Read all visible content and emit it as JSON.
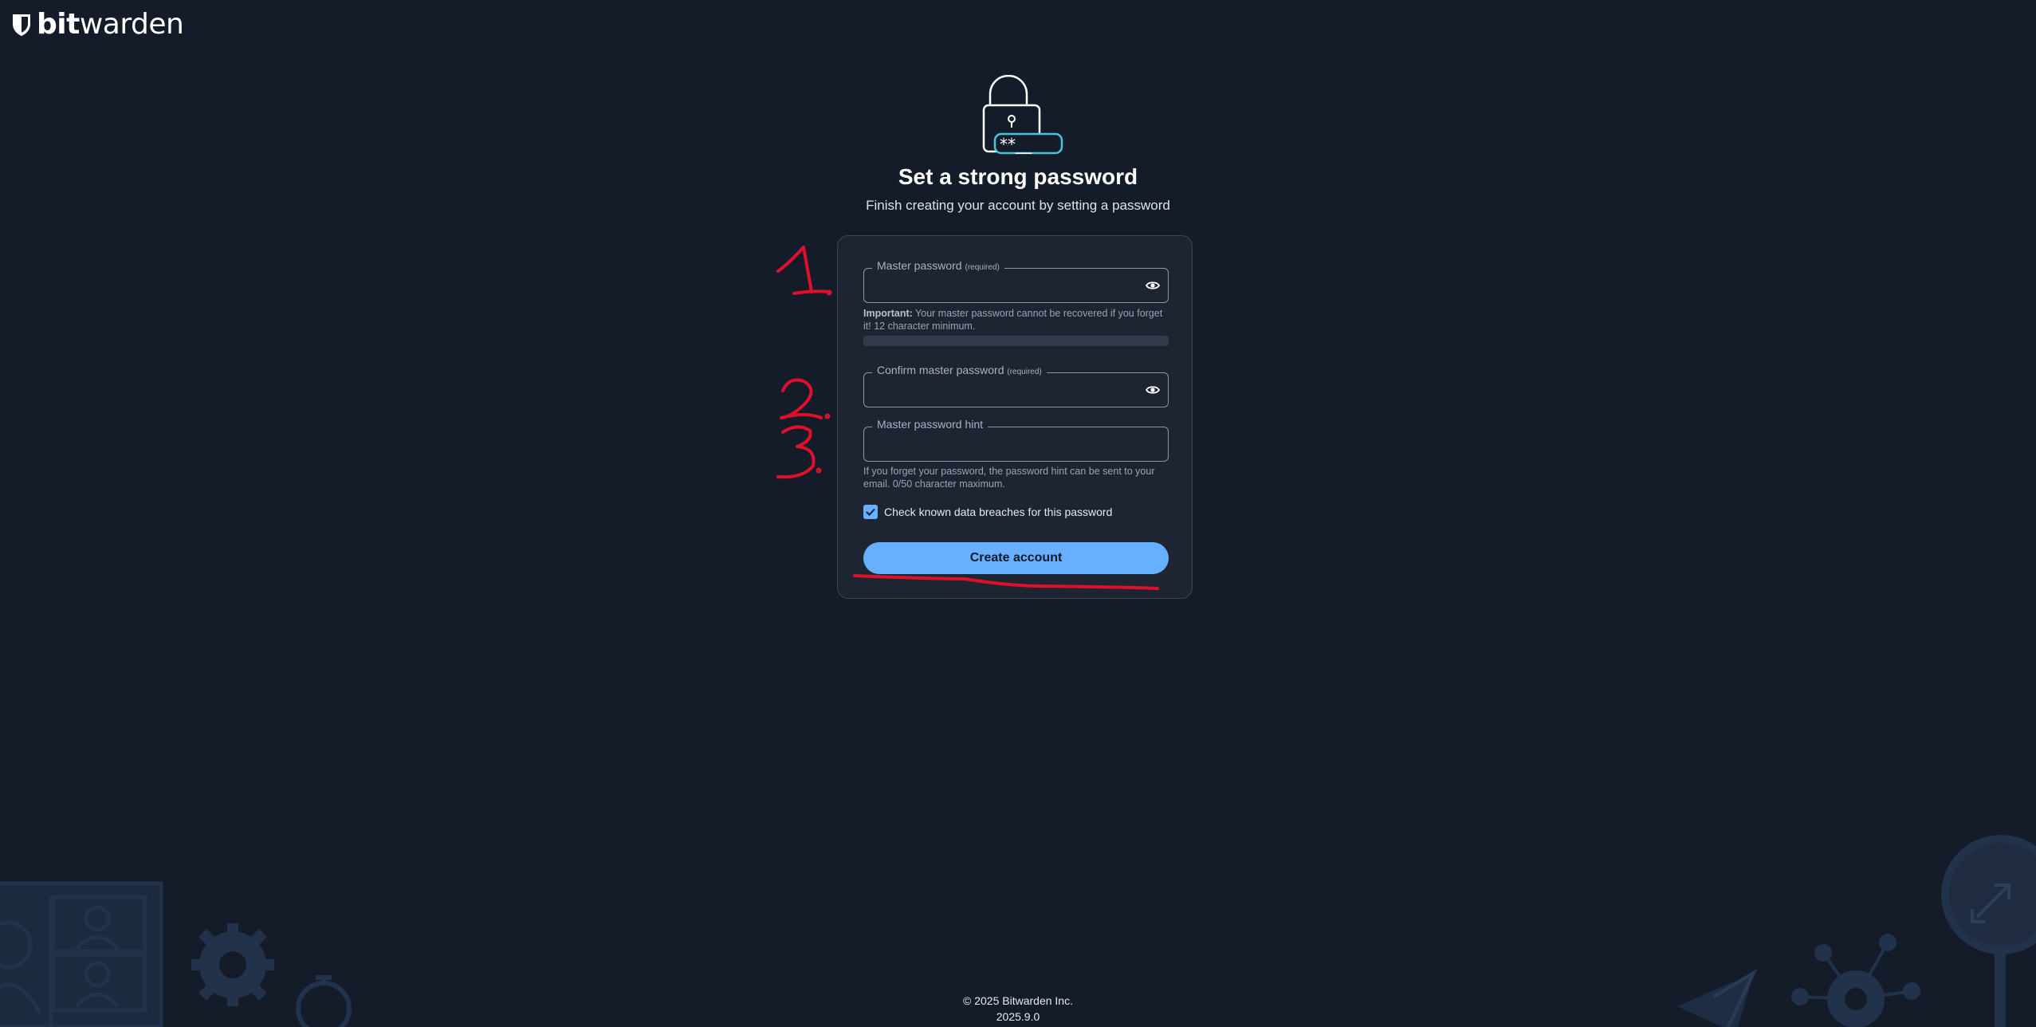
{
  "brand": {
    "bold": "bit",
    "rest": "warden"
  },
  "header": {
    "title": "Set a strong password",
    "subtitle": "Finish creating your account by setting a password"
  },
  "hero_icon": "lock-password-icon",
  "form": {
    "master_password": {
      "label": "Master password",
      "required": "(required)",
      "value": "",
      "help_bold": "Important:",
      "help": " Your master password cannot be recovered if you forget it! 12 character minimum."
    },
    "strength_meter": {
      "level": 0
    },
    "confirm_password": {
      "label": "Confirm master password",
      "required": "(required)",
      "value": ""
    },
    "hint": {
      "label": "Master password hint",
      "value": "",
      "help": "If you forget your password, the password hint can be sent to your email. 0/50 character maximum."
    },
    "breach_check": {
      "label": "Check known data breaches for this password",
      "checked": true
    },
    "submit_label": "Create account"
  },
  "annotations": [
    "1.",
    "2.",
    "3."
  ],
  "footer": {
    "copyright": "© 2025 Bitwarden Inc.",
    "version": "2025.9.0"
  },
  "colors": {
    "background": "#151c29",
    "card": "#1d2432",
    "accent": "#66b0ff",
    "annotation": "#e0102c"
  }
}
